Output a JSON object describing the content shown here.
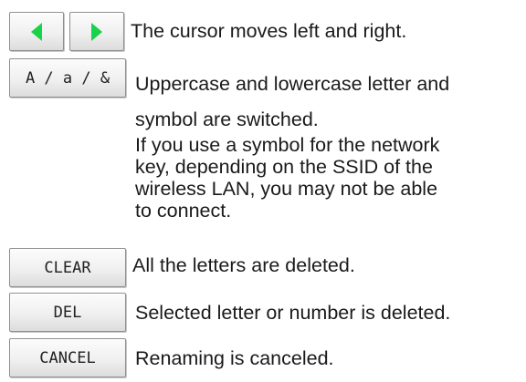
{
  "cursor_row": {
    "left_icon": "green-left-triangle",
    "right_icon": "green-right-triangle",
    "description": "The cursor moves left and right."
  },
  "case_row": {
    "key_label": "A / a / &",
    "description": "Uppercase and lowercase letter and",
    "continuation": "symbol are switched.",
    "note": "If you use a symbol for the network\nkey, depending on the SSID of the\nwireless LAN, you may not be able\nto connect."
  },
  "clear_row": {
    "key_label": "CLEAR",
    "description": "All the letters are deleted."
  },
  "del_row": {
    "key_label": "DEL",
    "description": "Selected letter or number is deleted."
  },
  "cancel_row": {
    "key_label": "CANCEL",
    "description": "Renaming is canceled."
  },
  "colors": {
    "arrow": "#18d24a",
    "key_border": "#8f8f8f",
    "text": "#1a1a1a"
  }
}
